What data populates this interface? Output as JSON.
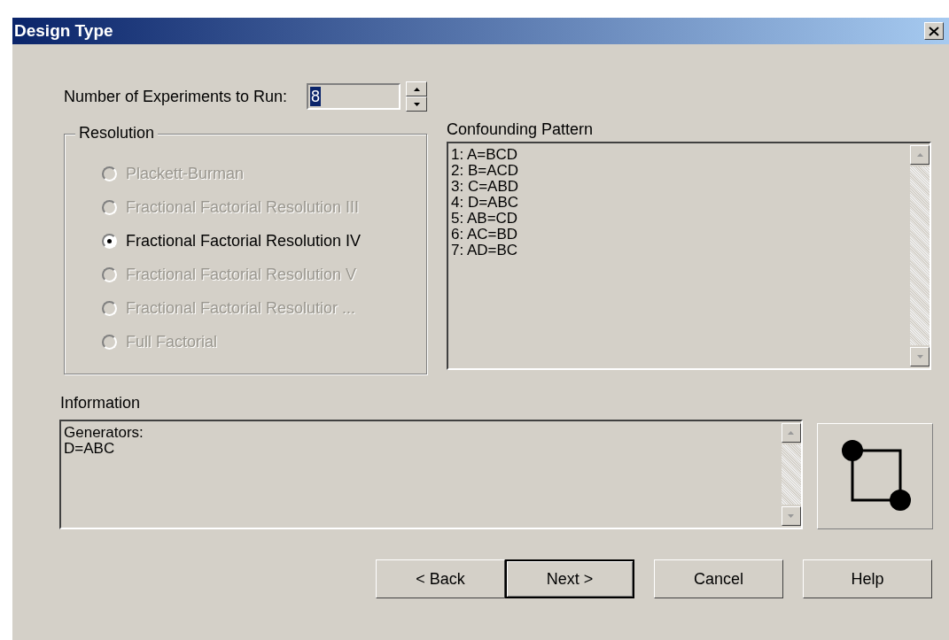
{
  "window": {
    "title": "Design Type"
  },
  "experiments": {
    "label": "Number of Experiments to Run:",
    "value": "8"
  },
  "resolution": {
    "title": "Resolution",
    "options": [
      {
        "label": "Plackett-Burman",
        "selected": false,
        "disabled": true
      },
      {
        "label": "Fractional Factorial Resolution III",
        "selected": false,
        "disabled": true
      },
      {
        "label": "Fractional Factorial Resolution IV",
        "selected": true,
        "disabled": false
      },
      {
        "label": "Fractional Factorial Resolution V",
        "selected": false,
        "disabled": true
      },
      {
        "label": "Fractional Factorial Resolutior ...",
        "selected": false,
        "disabled": true
      },
      {
        "label": "Full Factorial",
        "selected": false,
        "disabled": true
      }
    ]
  },
  "confounding_pattern": {
    "label": "Confounding Pattern",
    "lines": [
      "1: A=BCD",
      "2: B=ACD",
      "3: C=ABD",
      "4: D=ABC",
      "5: AB=CD",
      "6: AC=BD",
      "7: AD=BC"
    ]
  },
  "information": {
    "label": "Information",
    "lines": [
      "Generators:",
      "D=ABC"
    ]
  },
  "buttons": [
    {
      "label": "< Back",
      "default": false
    },
    {
      "label": "Next >",
      "default": true
    },
    {
      "label": "Cancel",
      "default": false
    },
    {
      "label": "Help",
      "default": false
    }
  ]
}
